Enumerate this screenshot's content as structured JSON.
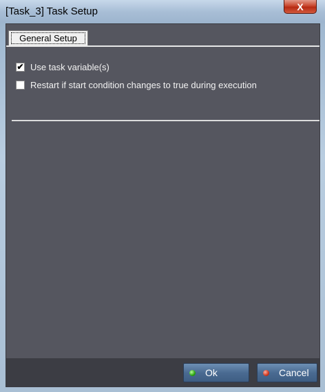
{
  "window": {
    "title": "[Task_3] Task Setup",
    "close_symbol": "X"
  },
  "tabs": [
    {
      "label": "General Setup",
      "selected": true
    }
  ],
  "options": [
    {
      "label": "Use task variable(s)",
      "checked": true,
      "check_glyph": "✔"
    },
    {
      "label": "Restart if start condition changes to true during execution",
      "checked": false,
      "check_glyph": ""
    }
  ],
  "footer": {
    "ok_label": "Ok",
    "cancel_label": "Cancel",
    "ok_icon": "green-dot-icon",
    "cancel_icon": "red-dot-icon"
  },
  "colors": {
    "panel": "#55565f",
    "footer": "#3c3d44",
    "button": "#4a6b92"
  }
}
